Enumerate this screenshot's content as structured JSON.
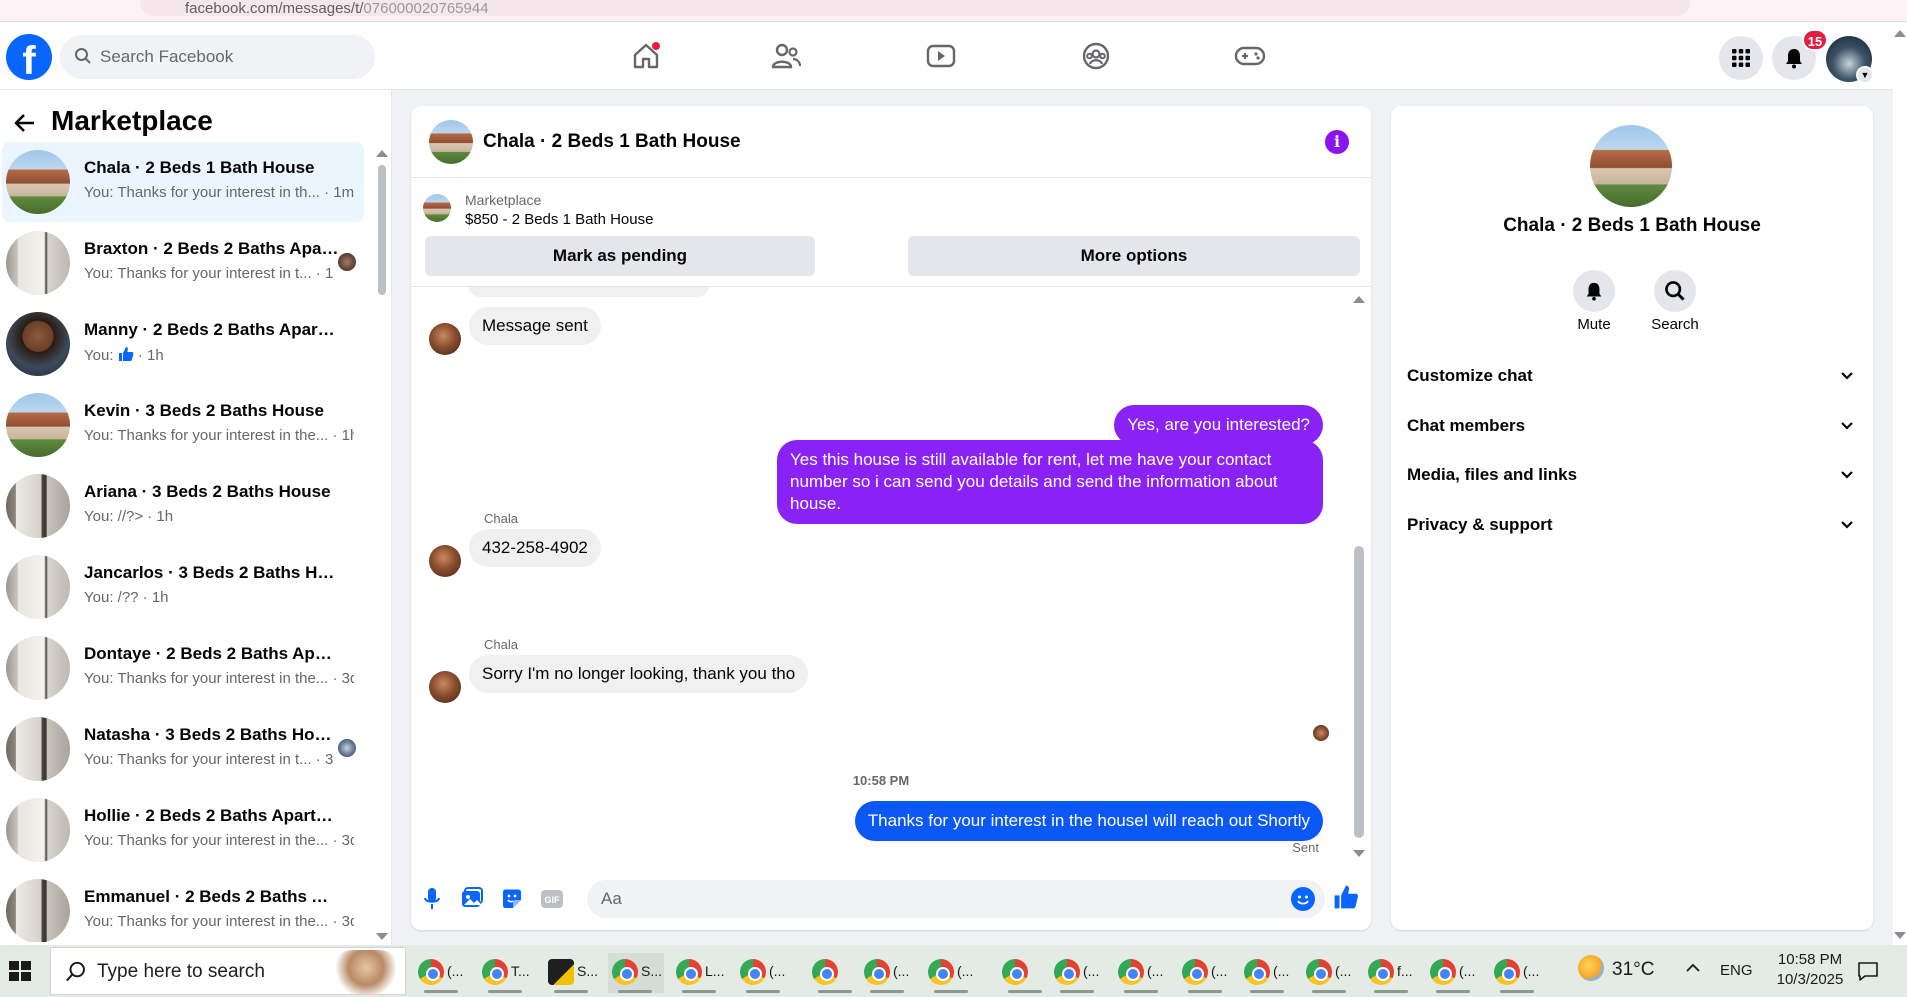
{
  "browser": {
    "url": "facebook.com/messages/t/",
    "url_tail": "076000020765944"
  },
  "topbar": {
    "search_placeholder": "Search Facebook",
    "notification_count": "15",
    "nav": [
      "home-icon",
      "friends-icon",
      "video-icon",
      "groups-icon",
      "gaming-icon"
    ]
  },
  "left": {
    "title": "Marketplace",
    "conversations": [
      {
        "name": "Chala · 2 Beds 1 Bath House",
        "preview": "You: Thanks for your interest in th... · 1m",
        "avatar": "house"
      },
      {
        "name": "Braxton · 2 Beds 2 Baths Apar...",
        "preview": "You: Thanks for your interest in t... · 1h",
        "avatar": "room"
      },
      {
        "name": "Manny · 2 Beds 2 Baths Apartm...",
        "preview_prefix": "You:",
        "preview_suffix": " · 1h",
        "avatar": "person"
      },
      {
        "name": "Kevin · 3 Beds 2 Baths House",
        "preview": "You: Thanks for your interest in the... · 1h",
        "avatar": "house"
      },
      {
        "name": "Ariana · 3 Beds 2 Baths House",
        "preview": "You: //?> · 1h",
        "avatar": "room2"
      },
      {
        "name": "Jancarlos · 3 Beds 2 Baths House",
        "preview": "You: /?? · 1h",
        "avatar": "room"
      },
      {
        "name": "Dontaye · 2 Beds 2 Baths Apart...",
        "preview": "You: Thanks for your interest in the... · 3d",
        "avatar": "room"
      },
      {
        "name": "Natasha · 3 Beds 2 Baths House",
        "preview": "You: Thanks for your interest in t... · 3d",
        "avatar": "room2"
      },
      {
        "name": "Hollie · 2 Beds 2 Baths Apartme...",
        "preview": "You: Thanks for your interest in the... · 3d",
        "avatar": "room"
      },
      {
        "name": "Emmanuel · 2 Beds 2 Baths Apa...",
        "preview": "You: Thanks for your interest in the... · 3d",
        "avatar": "room2"
      }
    ]
  },
  "chat": {
    "title": "Chala · 2 Beds 1 Bath House",
    "marketplace_label": "Marketplace",
    "listing": "$850 - 2 Beds 1 Bath House",
    "mark_pending": "Mark as pending",
    "more_options": "More options",
    "messages": {
      "m1": "Message sent",
      "m2": "Yes, are you interested?",
      "m3": "Yes this house is still available for rent, let me have your contact number so i can send you details and send the information about house.",
      "sender": "Chala",
      "m4": "432-258-4902",
      "m5": "Sorry I'm no longer looking, thank you tho",
      "time": "10:58 PM",
      "m6": "Thanks for your interest in the houseI will reach out Shortly",
      "status": "Sent"
    },
    "composer_placeholder": "Aa"
  },
  "info": {
    "title": "Chala · 2 Beds 1 Bath House",
    "mute": "Mute",
    "search": "Search",
    "sections": [
      "Customize chat",
      "Chat members",
      "Media, files and links",
      "Privacy & support"
    ]
  },
  "taskbar": {
    "search_placeholder": "Type here to search",
    "apps": [
      "(...",
      "T...",
      "S...",
      "S...",
      "L...",
      "(...",
      "",
      "(...",
      "(...",
      "",
      "(...",
      "(...",
      "(...",
      "(...",
      "(...",
      "f...",
      "(...",
      "(..."
    ],
    "temp": "31°C",
    "lang": "ENG",
    "time": "10:58 PM",
    "date": "10/3/2025"
  },
  "colors": {
    "fb_blue": "#0866ff",
    "outgoing_purple": "#8a22f5",
    "outgoing_blue": "#0b58f5",
    "badge_red": "#e41e3f"
  }
}
